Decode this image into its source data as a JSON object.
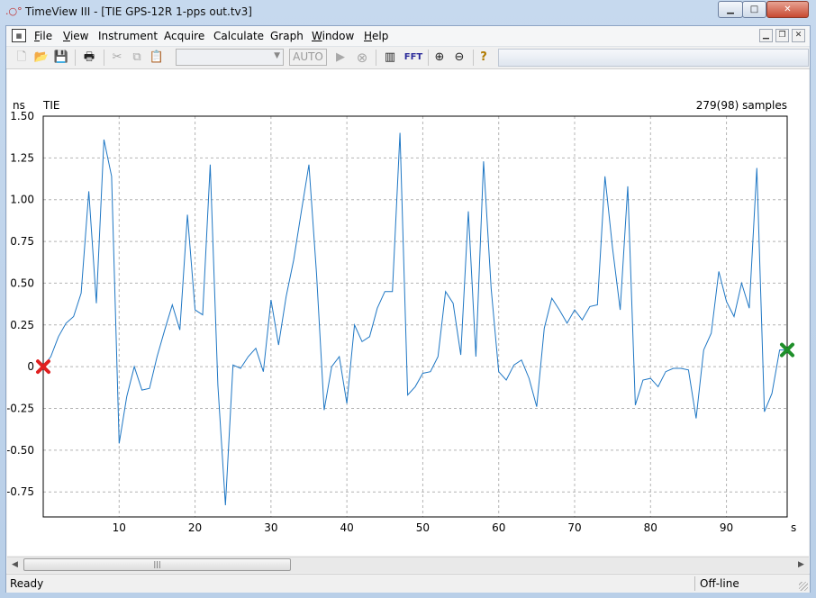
{
  "window": {
    "title": "TimeView III - [TIE GPS-12R 1-pps out.tv3]",
    "app_icon": "timeview-app-icon",
    "controls": [
      "minimize-icon",
      "maximize-icon",
      "close-icon"
    ]
  },
  "menubar": {
    "items": [
      {
        "label": "File",
        "mnemonic": "F"
      },
      {
        "label": "View",
        "mnemonic": "V"
      },
      {
        "label": "Instrument",
        "mnemonic": ""
      },
      {
        "label": "Acquire",
        "mnemonic": ""
      },
      {
        "label": "Calculate",
        "mnemonic": ""
      },
      {
        "label": "Graph",
        "mnemonic": ""
      },
      {
        "label": "Window",
        "mnemonic": "W"
      },
      {
        "label": "Help",
        "mnemonic": "H"
      }
    ]
  },
  "toolbar": {
    "combo_value": "",
    "auto_label": "AUTO",
    "fft_label": "FFT",
    "icons": [
      "new-document-icon",
      "open-folder-icon",
      "save-icon",
      "print-icon",
      "cut-icon",
      "copy-icon",
      "paste-icon",
      "run-icon",
      "stop-icon",
      "histogram-icon",
      "fft-icon",
      "zoom-in-icon",
      "zoom-out-icon",
      "help-icon"
    ]
  },
  "status": {
    "left": "Ready",
    "right": "Off-line"
  },
  "chart_data": {
    "type": "line",
    "title": "TIE",
    "ylabel": "ns",
    "xlabel": "s",
    "sample_info": "279(98) samples",
    "xlim": [
      0,
      98
    ],
    "ylim": [
      -0.9,
      1.5
    ],
    "xticks": [
      10,
      20,
      30,
      40,
      50,
      60,
      70,
      80,
      90
    ],
    "yticks": [
      1.5,
      1.25,
      1.0,
      0.75,
      0.5,
      0.25,
      0,
      -0.25,
      -0.5,
      -0.75
    ],
    "ytick_labels": [
      "1.50",
      "1.25",
      "1.00",
      "0.75",
      "0.50",
      "0.25",
      "0",
      "-0.25",
      "-0.50",
      "-0.75"
    ],
    "grid": true,
    "series_color": "#1f77c4",
    "series": [
      {
        "x": [
          0,
          1,
          2,
          3,
          4,
          5,
          6,
          7,
          8,
          9,
          10,
          11,
          12,
          13,
          14,
          15,
          16,
          17,
          18,
          19,
          20,
          21,
          22,
          23,
          24,
          25,
          26,
          27,
          28,
          29,
          30,
          31,
          32,
          33,
          34,
          35,
          36,
          37,
          38,
          39,
          40,
          41,
          42,
          43,
          44,
          45,
          46,
          47,
          48,
          49,
          50,
          51,
          52,
          53,
          54,
          55,
          56,
          57,
          58,
          59,
          60,
          61,
          62,
          63,
          64,
          65,
          66,
          67,
          68,
          69,
          70,
          71,
          72,
          73,
          74,
          75,
          76,
          77,
          78,
          79,
          80,
          81,
          82,
          83,
          84,
          85,
          86,
          87,
          88,
          89,
          90,
          91,
          92,
          93,
          94,
          95,
          96,
          97,
          98
        ],
        "y": [
          0,
          0.06,
          0.18,
          0.26,
          0.3,
          0.44,
          1.05,
          0.38,
          1.36,
          1.14,
          -0.46,
          -0.18,
          0,
          -0.14,
          -0.13,
          0.06,
          0.22,
          0.37,
          0.22,
          0.91,
          0.34,
          0.31,
          1.21,
          -0.11,
          -0.83,
          0.01,
          -0.01,
          0.06,
          0.11,
          -0.03,
          0.4,
          0.13,
          0.42,
          0.64,
          0.93,
          1.21,
          0.56,
          -0.26,
          0.0,
          0.06,
          -0.22,
          0.25,
          0.15,
          0.18,
          0.35,
          0.45,
          0.45,
          1.4,
          -0.17,
          -0.12,
          -0.04,
          -0.03,
          0.06,
          0.45,
          0.38,
          0.07,
          0.93,
          0.06,
          1.23,
          0.47,
          -0.03,
          -0.08,
          0.01,
          0.04,
          -0.07,
          -0.24,
          0.23,
          0.41,
          0.34,
          0.26,
          0.34,
          0.28,
          0.36,
          0.37,
          1.14,
          0.71,
          0.34,
          1.08,
          -0.23,
          -0.08,
          -0.07,
          -0.12,
          -0.03,
          -0.01,
          -0.01,
          -0.02,
          -0.31,
          0.1,
          0.2,
          0.57,
          0.39,
          0.3,
          0.5,
          0.35,
          1.19,
          -0.27,
          -0.16,
          0.1,
          0.1
        ]
      }
    ],
    "markers": [
      {
        "name": "start-marker",
        "x": 0,
        "y": 0,
        "color": "#e02020"
      },
      {
        "name": "end-marker",
        "x": 98,
        "y": 0.1,
        "color": "#1f8f2a"
      }
    ]
  }
}
